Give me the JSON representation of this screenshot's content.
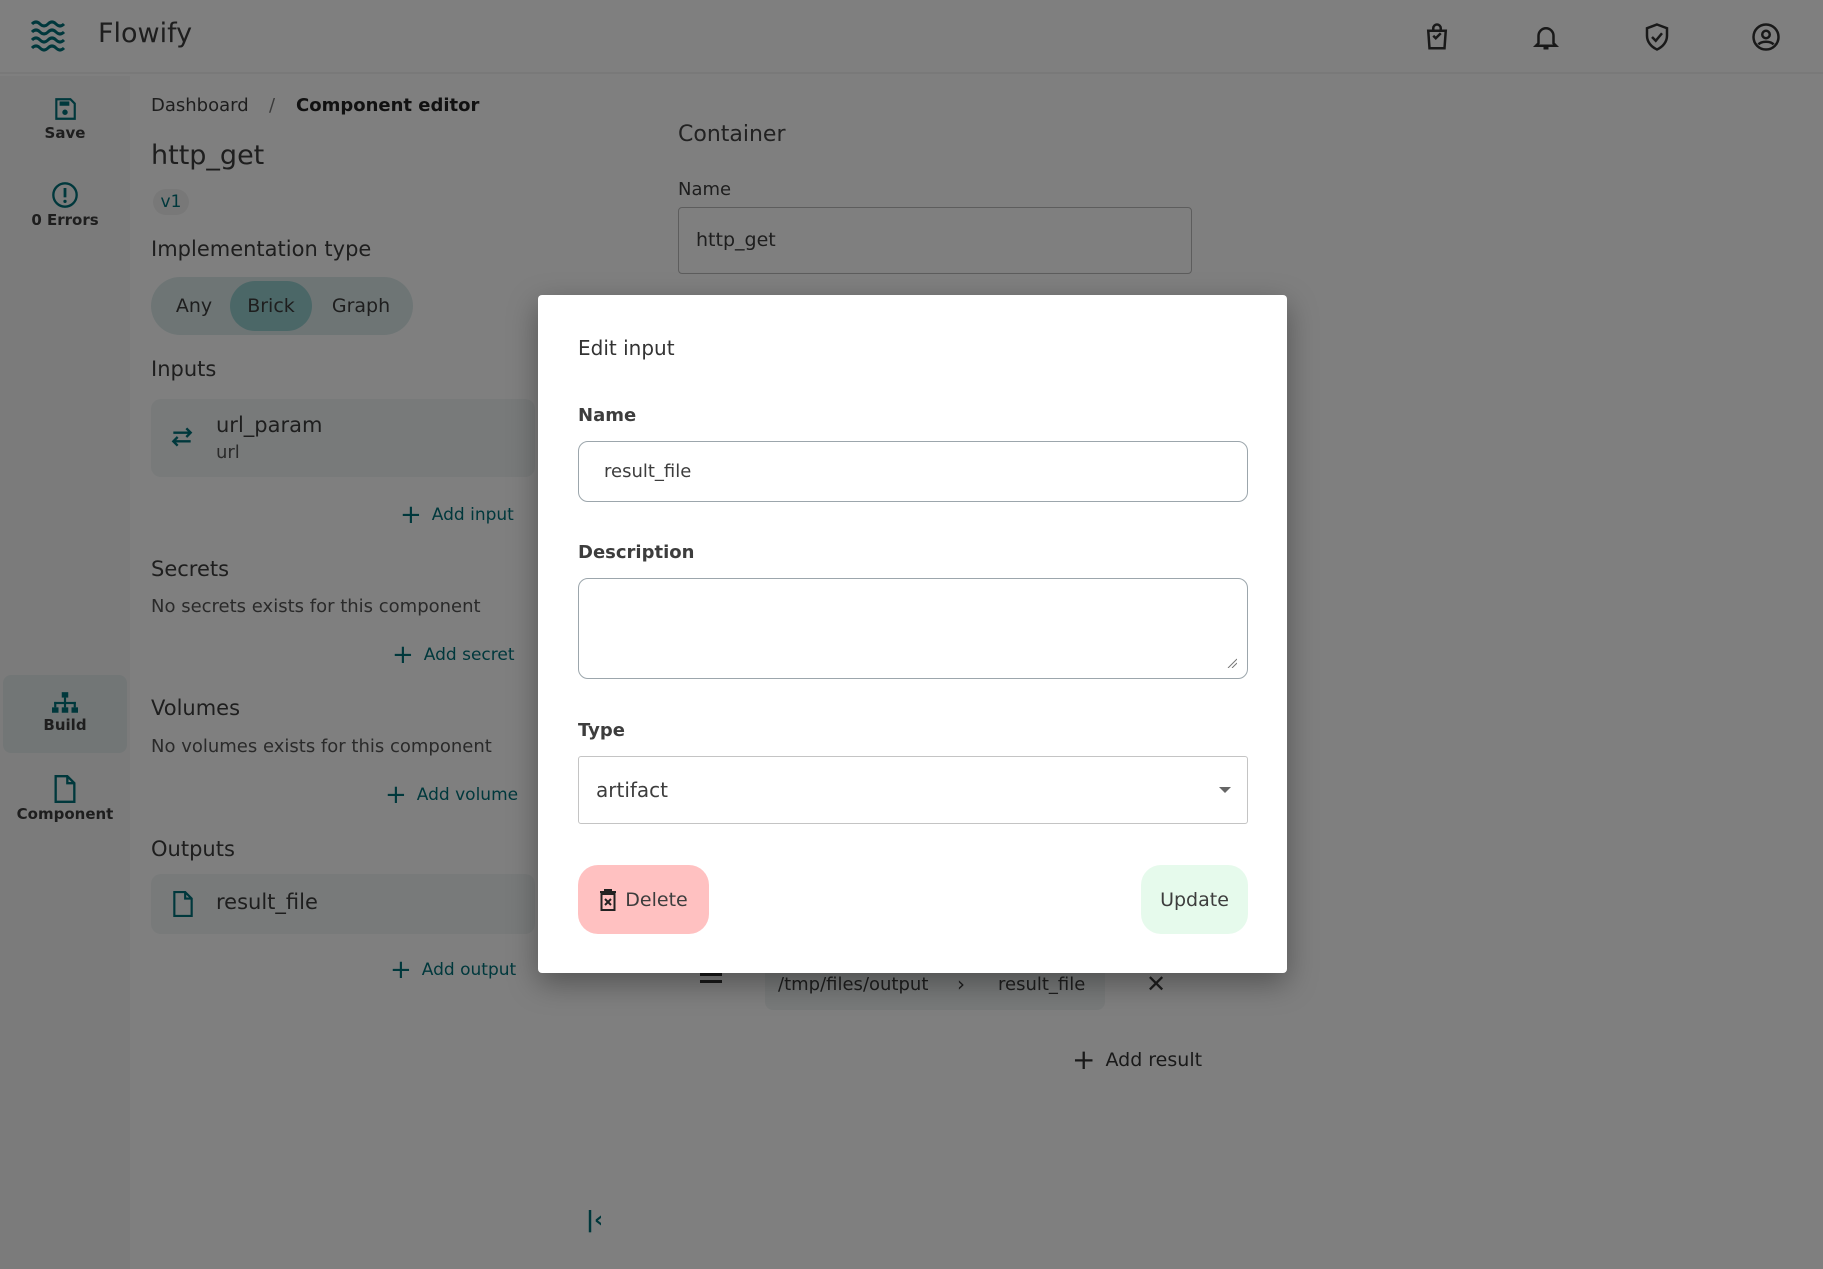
{
  "app": {
    "title": "Flowify"
  },
  "header": {
    "icons": [
      "shopping-bag-icon",
      "bell-icon",
      "shield-check-icon",
      "account-circle-icon"
    ]
  },
  "sidebar": {
    "items": [
      {
        "label": "Save",
        "icon": "save-icon"
      },
      {
        "label": "0 Errors",
        "icon": "error-outline-icon"
      },
      {
        "label": "Build",
        "icon": "sitemap-icon",
        "active": true
      },
      {
        "label": "Component",
        "icon": "file-icon"
      }
    ]
  },
  "breadcrumb": {
    "items": [
      "Dashboard",
      "Component editor"
    ],
    "separator": "/"
  },
  "component": {
    "name": "http_get",
    "version": "v1"
  },
  "implementation": {
    "label": "Implementation type",
    "options": [
      "Any",
      "Brick",
      "Graph"
    ],
    "selected": "Brick"
  },
  "inputs": {
    "label": "Inputs",
    "items": [
      {
        "name": "url_param",
        "type": "url"
      }
    ],
    "add_label": "Add input"
  },
  "secrets": {
    "label": "Secrets",
    "empty": "No secrets exists for this component",
    "add_label": "Add secret"
  },
  "volumes": {
    "label": "Volumes",
    "empty": "No volumes exists for this component",
    "add_label": "Add volume"
  },
  "outputs": {
    "label": "Outputs",
    "items": [
      {
        "name": "result_file"
      }
    ],
    "add_label": "Add output"
  },
  "container": {
    "label": "Container",
    "name_label": "Name",
    "name_value": "http_get",
    "results": [
      {
        "path": "/tmp/files/output",
        "target": "result_file"
      }
    ],
    "add_result_label": "Add result"
  },
  "modal": {
    "title": "Edit input",
    "name_label": "Name",
    "name_value": "result_file",
    "description_label": "Description",
    "description_value": "",
    "type_label": "Type",
    "type_value": "artifact",
    "delete_label": "Delete",
    "update_label": "Update"
  },
  "colors": {
    "accent": "#007079",
    "delete_bg": "#ffc1c1",
    "update_bg": "#e6faec"
  }
}
